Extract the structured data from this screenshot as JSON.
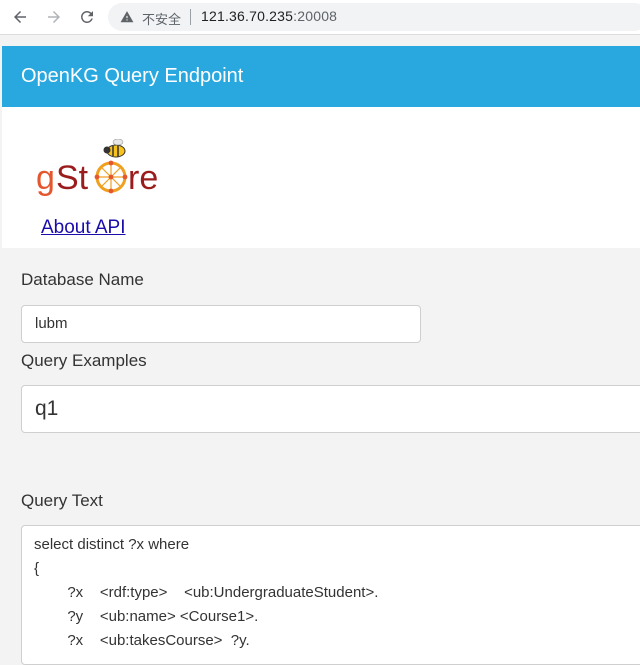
{
  "browser": {
    "security_label": "不安全",
    "url_host": "121.36.70.235",
    "url_port": ":20008"
  },
  "header": {
    "title": "OpenKG Query Endpoint"
  },
  "hero": {
    "logo_text": "gStore",
    "about_link": "About API"
  },
  "form": {
    "database_label": "Database Name",
    "database_value": "lubm",
    "examples_label": "Query Examples",
    "examples_value": "q1",
    "query_label": "Query Text",
    "query_lines": [
      "select distinct ?x where",
      "{",
      "        ?x    <rdf:type>    <ub:UndergraduateStudent>.",
      "        ?y    <ub:name> <Course1>.",
      "        ?x    <ub:takesCourse>  ?y."
    ]
  }
}
